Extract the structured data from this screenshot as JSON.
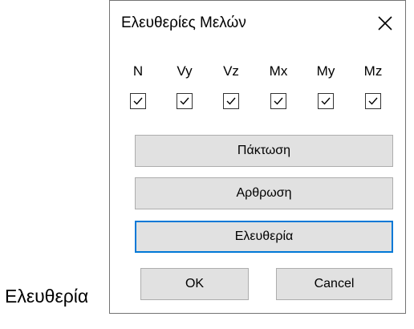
{
  "caption": "Ελευθερία",
  "dialog": {
    "title": "Ελευθερίες Μελών",
    "close_icon": "close-icon",
    "dofs": [
      {
        "label": "N",
        "checked": true
      },
      {
        "label": "Vy",
        "checked": true
      },
      {
        "label": "Vz",
        "checked": true
      },
      {
        "label": "Mx",
        "checked": true
      },
      {
        "label": "My",
        "checked": true
      },
      {
        "label": "Mz",
        "checked": true
      }
    ],
    "buttons": {
      "fixed": "Πάκτωση",
      "hinged": "Αρθρωση",
      "free": "Ελευθερία",
      "ok": "OK",
      "cancel": "Cancel"
    }
  },
  "colors": {
    "button_face": "#e1e1e1",
    "button_border": "#adadad",
    "focus_border": "#0078d7",
    "window_border": "#737373"
  }
}
